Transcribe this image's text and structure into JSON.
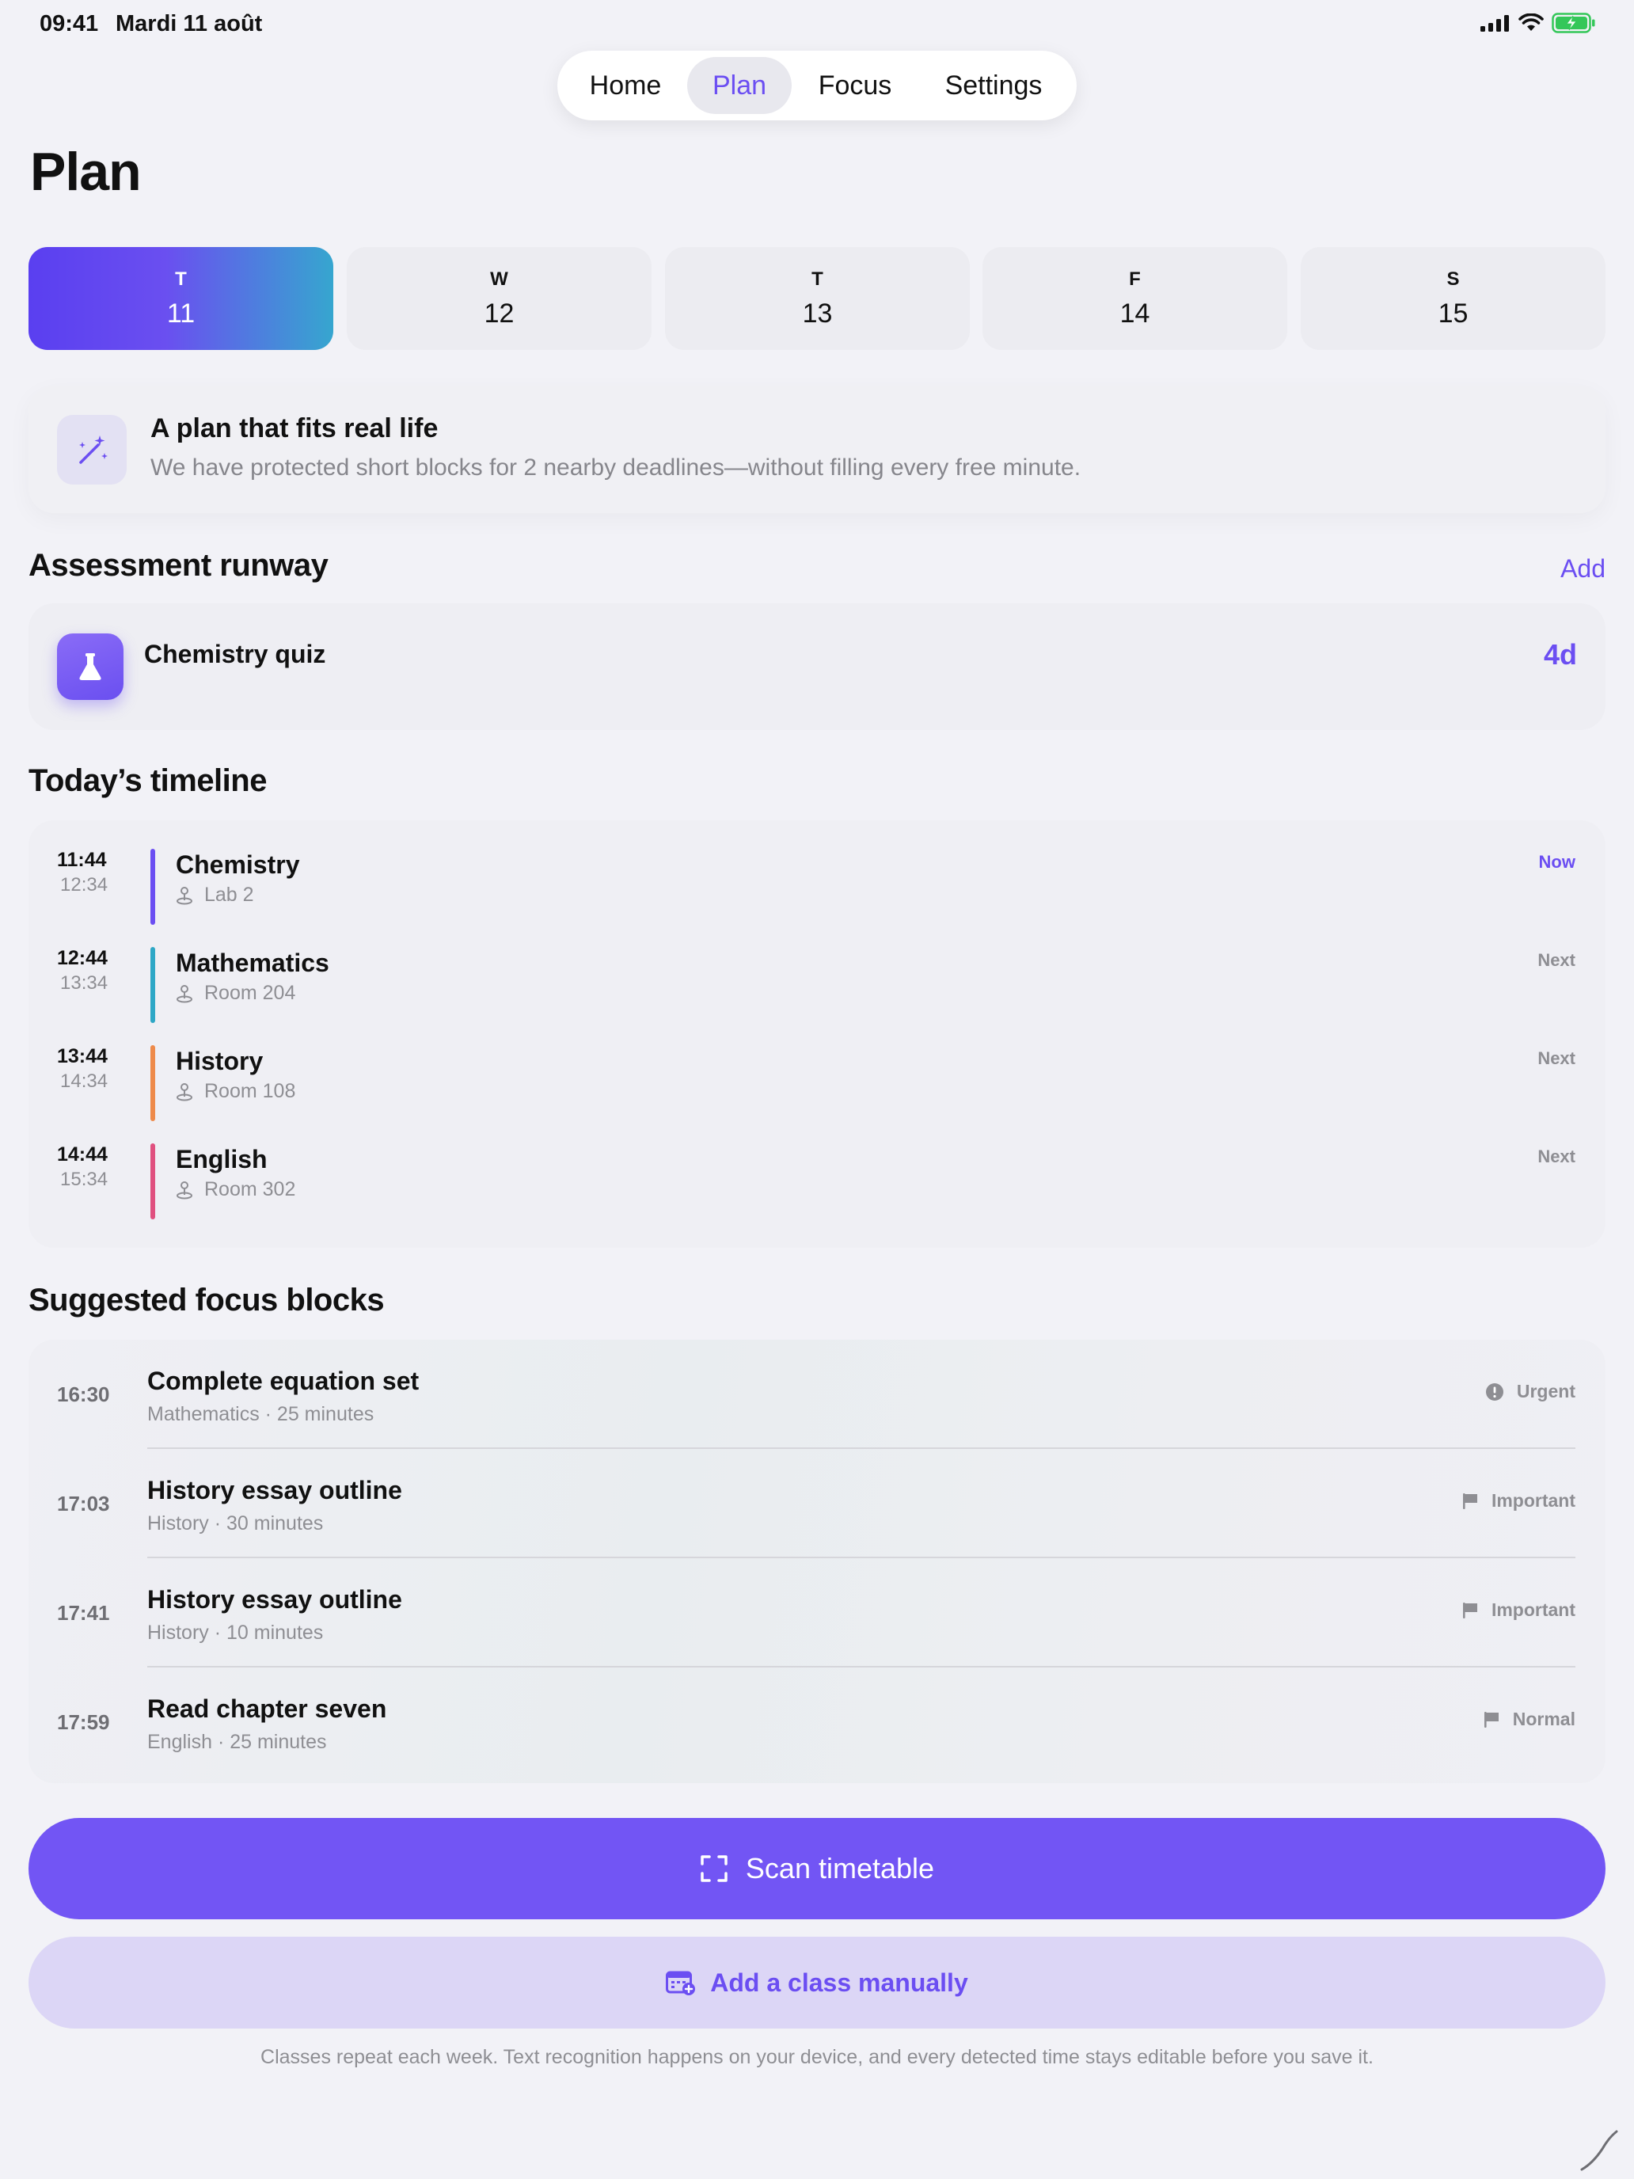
{
  "status": {
    "time": "09:41",
    "date": "Mardi 11 août",
    "icons": [
      "cellular-signal-icon",
      "wifi-icon",
      "battery-charging-icon"
    ]
  },
  "nav": {
    "tabs": [
      {
        "label": "Home"
      },
      {
        "label": "Plan",
        "active": true
      },
      {
        "label": "Focus"
      },
      {
        "label": "Settings"
      }
    ]
  },
  "page": {
    "title": "Plan"
  },
  "days": [
    {
      "dow": "T",
      "num": "11",
      "selected": true
    },
    {
      "dow": "W",
      "num": "12"
    },
    {
      "dow": "T",
      "num": "13"
    },
    {
      "dow": "F",
      "num": "14"
    },
    {
      "dow": "S",
      "num": "15"
    }
  ],
  "info": {
    "icon": "magic-wand-icon",
    "title": "A plan that fits real life",
    "body": "We have protected short blocks for 2 nearby deadlines—without filling every free minute."
  },
  "assessment": {
    "heading": "Assessment runway",
    "add_label": "Add",
    "items": [
      {
        "icon": "flask-icon",
        "name": "Chemistry quiz",
        "days_left": "4d"
      }
    ]
  },
  "timeline": {
    "heading": "Today’s timeline",
    "items": [
      {
        "start": "11:44",
        "end": "12:34",
        "subject": "Chemistry",
        "room": "Lab 2",
        "status": "Now",
        "color": "#6b4ef2"
      },
      {
        "start": "12:44",
        "end": "13:34",
        "subject": "Mathematics",
        "room": "Room 204",
        "status": "Next",
        "color": "#2ea7c6"
      },
      {
        "start": "13:44",
        "end": "14:34",
        "subject": "History",
        "room": "Room 108",
        "status": "Next",
        "color": "#ee8a4a"
      },
      {
        "start": "14:44",
        "end": "15:34",
        "subject": "English",
        "room": "Room 302",
        "status": "Next",
        "color": "#e0507f"
      }
    ]
  },
  "focus": {
    "heading": "Suggested focus blocks",
    "items": [
      {
        "time": "16:30",
        "title": "Complete equation set",
        "meta": "Mathematics · 25 minutes",
        "priority": "Urgent",
        "icon": "exclamation-circle-icon"
      },
      {
        "time": "17:03",
        "title": "History essay outline",
        "meta": "History · 30 minutes",
        "priority": "Important",
        "icon": "flag-icon"
      },
      {
        "time": "17:41",
        "title": "History essay outline",
        "meta": "History · 10 minutes",
        "priority": "Important",
        "icon": "flag-icon"
      },
      {
        "time": "17:59",
        "title": "Read chapter seven",
        "meta": "English · 25 minutes",
        "priority": "Normal",
        "icon": "flag-icon"
      }
    ]
  },
  "actions": {
    "scan_label": "Scan timetable",
    "add_manual_label": "Add a class manually",
    "accent": "#7255f4"
  },
  "footnote": "Classes repeat each week. Text recognition happens on your device, and every detected time stays editable before you save it."
}
